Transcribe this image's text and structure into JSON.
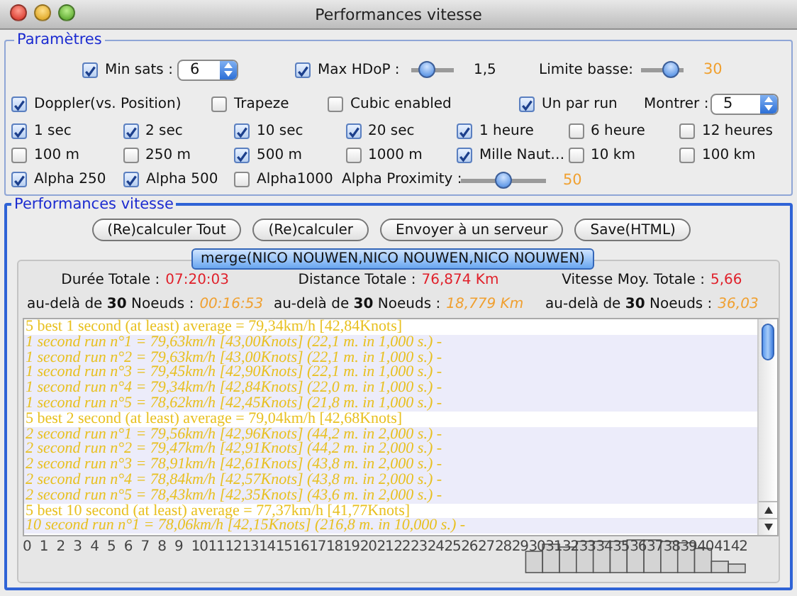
{
  "window": {
    "title": "Performances vitesse"
  },
  "parametres": {
    "title": "Paramètres",
    "limits": [
      {
        "kind": "checkbox",
        "label": "Min sats :",
        "checked": true
      },
      {
        "kind": "spinner",
        "value": "6"
      },
      {
        "kind": "checkbox",
        "label": "Max HDoP :",
        "checked": true
      },
      {
        "kind": "slider",
        "level": 0.25
      },
      {
        "kind": "reading",
        "text": "1,5"
      },
      {
        "kind": "label",
        "text": "Limite basse:"
      },
      {
        "kind": "slider",
        "level": 0.85
      },
      {
        "kind": "value",
        "text": "30"
      }
    ],
    "options": [
      {
        "kind": "checkbox",
        "label": "Doppler(vs. Position)",
        "checked": true
      },
      {
        "kind": "checkbox",
        "label": "Trapeze",
        "checked": false
      },
      {
        "kind": "checkbox",
        "label": "Cubic enabled",
        "checked": false
      },
      {
        "kind": "checkbox",
        "label": "Un par run",
        "checked": true
      },
      {
        "kind": "label",
        "text": "Montrer :"
      },
      {
        "kind": "spinner",
        "value": "5"
      }
    ],
    "durations": [
      {
        "kind": "checkbox",
        "label": "1 sec",
        "checked": true
      },
      {
        "kind": "checkbox",
        "label": "2 sec",
        "checked": true
      },
      {
        "kind": "checkbox",
        "label": "10 sec",
        "checked": true
      },
      {
        "kind": "checkbox",
        "label": "20 sec",
        "checked": true
      },
      {
        "kind": "checkbox",
        "label": "1 heure",
        "checked": true
      },
      {
        "kind": "checkbox",
        "label": "6 heure",
        "checked": false
      },
      {
        "kind": "checkbox",
        "label": "12 heures",
        "checked": false
      }
    ],
    "distances": [
      {
        "kind": "checkbox",
        "label": "100 m",
        "checked": false
      },
      {
        "kind": "checkbox",
        "label": "250 m",
        "checked": false
      },
      {
        "kind": "checkbox",
        "label": "500 m",
        "checked": true
      },
      {
        "kind": "checkbox",
        "label": "1000 m",
        "checked": false
      },
      {
        "kind": "checkbox",
        "label": "Mille Naut…",
        "checked": true
      },
      {
        "kind": "checkbox",
        "label": "10 km",
        "checked": false
      },
      {
        "kind": "checkbox",
        "label": "100 km",
        "checked": false
      }
    ],
    "alpha": [
      {
        "kind": "checkbox",
        "label": "Alpha 250",
        "checked": true
      },
      {
        "kind": "checkbox",
        "label": "Alpha 500",
        "checked": true
      },
      {
        "kind": "checkbox",
        "label": "Alpha1000",
        "checked": false
      },
      {
        "kind": "label",
        "text": "Alpha Proximity :"
      },
      {
        "kind": "slider",
        "level": 0.5
      },
      {
        "kind": "value",
        "text": "50"
      }
    ]
  },
  "performances": {
    "title": "Performances vitesse",
    "buttons": [
      "(Re)calculer Tout",
      "(Re)calculer",
      "Envoyer à un serveur",
      "Save(HTML)"
    ],
    "merge_button": "merge(NICO NOUWEN,NICO NOUWEN,NICO NOUWEN)",
    "stats": [
      {
        "label": "Durée Totale :",
        "value": "07:20:03",
        "beyond_label": "au-delà de **30** Noeuds :",
        "beyond_value": "00:16:53"
      },
      {
        "label": "Distance Totale :",
        "value": "76,874 Km",
        "beyond_label": "au-delà de **30** Noeuds :",
        "beyond_value": "18,779 Km"
      },
      {
        "label": "Vitesse Moy. Totale :",
        "value": "5,66",
        "beyond_label": "au-delà de **30** Noeuds :",
        "beyond_value": "36,03"
      }
    ],
    "results": [
      {
        "kind": "header",
        "text": "5 best 1 second (at least) average = 79,34km/h [42,84Knots]"
      },
      {
        "kind": "run",
        "text": "1 second run n°1 = 79,63km/h [43,00Knots] (22,1 m. in 1,000 s.) -"
      },
      {
        "kind": "run",
        "text": "1 second run n°2 = 79,63km/h [43,00Knots] (22,1 m. in 1,000 s.) -"
      },
      {
        "kind": "run",
        "text": "1 second run n°3 = 79,45km/h [42,90Knots] (22,1 m. in 1,000 s.) -"
      },
      {
        "kind": "run",
        "text": "1 second run n°4 = 79,34km/h [42,84Knots] (22,0 m. in 1,000 s.) -"
      },
      {
        "kind": "run",
        "text": "1 second run n°5 = 78,62km/h [42,45Knots] (21,8 m. in 1,000 s.) -"
      },
      {
        "kind": "header",
        "text": "5 best 2 second (at least) average = 79,04km/h [42,68Knots]"
      },
      {
        "kind": "run",
        "text": "2 second run n°1 = 79,56km/h [42,96Knots] (44,2 m. in 2,000 s.) -"
      },
      {
        "kind": "run",
        "text": "2 second run n°2 = 79,47km/h [42,91Knots] (44,2 m. in 2,000 s.) -"
      },
      {
        "kind": "run",
        "text": "2 second run n°3 = 78,91km/h [42,61Knots] (43,8 m. in 2,000 s.) -"
      },
      {
        "kind": "run",
        "text": "2 second run n°4 = 78,84km/h [42,57Knots] (43,8 m. in 2,000 s.) -"
      },
      {
        "kind": "run",
        "text": "2 second run n°5 = 78,43km/h [42,35Knots] (43,6 m. in 2,000 s.) -"
      },
      {
        "kind": "header",
        "text": "5 best 10 second (at least) average = 77,37km/h [41,77Knots]"
      },
      {
        "kind": "run",
        "text": "10 second run n°1 = 78,06km/h [42,15Knots] (216,8 m. in 10,000 s.) -"
      }
    ],
    "histogram_labels": [
      "0",
      "1",
      "2",
      "3",
      "4",
      "5",
      "6",
      "7",
      "8",
      "9",
      "10",
      "11",
      "12",
      "13",
      "14",
      "15",
      "16",
      "17",
      "18",
      "19",
      "20",
      "21",
      "22",
      "23",
      "24",
      "25",
      "26",
      "27",
      "28",
      "29",
      "30",
      "31",
      "32",
      "33",
      "34",
      "35",
      "36",
      "37",
      "38",
      "39",
      "40",
      "41",
      "42"
    ]
  }
}
